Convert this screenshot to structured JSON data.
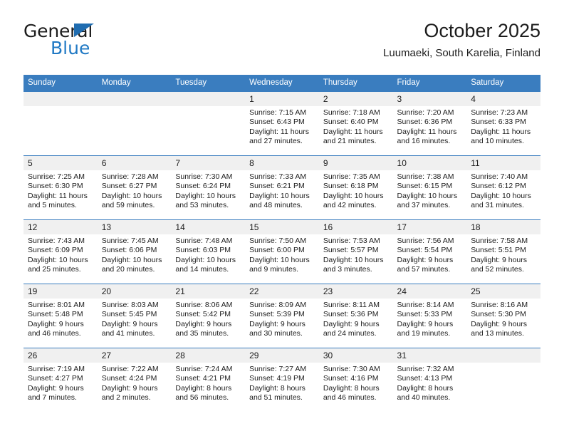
{
  "brand": {
    "name_top": "General",
    "name_bottom": "Blue",
    "accent_color": "#2079c4",
    "header_color": "#3a7dbf"
  },
  "header": {
    "title": "October 2025",
    "subtitle": "Luumaeki, South Karelia, Finland"
  },
  "weekday_headers": [
    "Sunday",
    "Monday",
    "Tuesday",
    "Wednesday",
    "Thursday",
    "Friday",
    "Saturday"
  ],
  "labels": {
    "sunrise": "Sunrise:",
    "sunset": "Sunset:",
    "daylight": "Daylight:"
  },
  "weeks": [
    [
      {
        "empty": true
      },
      {
        "empty": true
      },
      {
        "empty": true
      },
      {
        "day": "1",
        "sunrise": "Sunrise: 7:15 AM",
        "sunset": "Sunset: 6:43 PM",
        "daylight1": "Daylight: 11 hours",
        "daylight2": "and 27 minutes."
      },
      {
        "day": "2",
        "sunrise": "Sunrise: 7:18 AM",
        "sunset": "Sunset: 6:40 PM",
        "daylight1": "Daylight: 11 hours",
        "daylight2": "and 21 minutes."
      },
      {
        "day": "3",
        "sunrise": "Sunrise: 7:20 AM",
        "sunset": "Sunset: 6:36 PM",
        "daylight1": "Daylight: 11 hours",
        "daylight2": "and 16 minutes."
      },
      {
        "day": "4",
        "sunrise": "Sunrise: 7:23 AM",
        "sunset": "Sunset: 6:33 PM",
        "daylight1": "Daylight: 11 hours",
        "daylight2": "and 10 minutes."
      }
    ],
    [
      {
        "day": "5",
        "sunrise": "Sunrise: 7:25 AM",
        "sunset": "Sunset: 6:30 PM",
        "daylight1": "Daylight: 11 hours",
        "daylight2": "and 5 minutes."
      },
      {
        "day": "6",
        "sunrise": "Sunrise: 7:28 AM",
        "sunset": "Sunset: 6:27 PM",
        "daylight1": "Daylight: 10 hours",
        "daylight2": "and 59 minutes."
      },
      {
        "day": "7",
        "sunrise": "Sunrise: 7:30 AM",
        "sunset": "Sunset: 6:24 PM",
        "daylight1": "Daylight: 10 hours",
        "daylight2": "and 53 minutes."
      },
      {
        "day": "8",
        "sunrise": "Sunrise: 7:33 AM",
        "sunset": "Sunset: 6:21 PM",
        "daylight1": "Daylight: 10 hours",
        "daylight2": "and 48 minutes."
      },
      {
        "day": "9",
        "sunrise": "Sunrise: 7:35 AM",
        "sunset": "Sunset: 6:18 PM",
        "daylight1": "Daylight: 10 hours",
        "daylight2": "and 42 minutes."
      },
      {
        "day": "10",
        "sunrise": "Sunrise: 7:38 AM",
        "sunset": "Sunset: 6:15 PM",
        "daylight1": "Daylight: 10 hours",
        "daylight2": "and 37 minutes."
      },
      {
        "day": "11",
        "sunrise": "Sunrise: 7:40 AM",
        "sunset": "Sunset: 6:12 PM",
        "daylight1": "Daylight: 10 hours",
        "daylight2": "and 31 minutes."
      }
    ],
    [
      {
        "day": "12",
        "sunrise": "Sunrise: 7:43 AM",
        "sunset": "Sunset: 6:09 PM",
        "daylight1": "Daylight: 10 hours",
        "daylight2": "and 25 minutes."
      },
      {
        "day": "13",
        "sunrise": "Sunrise: 7:45 AM",
        "sunset": "Sunset: 6:06 PM",
        "daylight1": "Daylight: 10 hours",
        "daylight2": "and 20 minutes."
      },
      {
        "day": "14",
        "sunrise": "Sunrise: 7:48 AM",
        "sunset": "Sunset: 6:03 PM",
        "daylight1": "Daylight: 10 hours",
        "daylight2": "and 14 minutes."
      },
      {
        "day": "15",
        "sunrise": "Sunrise: 7:50 AM",
        "sunset": "Sunset: 6:00 PM",
        "daylight1": "Daylight: 10 hours",
        "daylight2": "and 9 minutes."
      },
      {
        "day": "16",
        "sunrise": "Sunrise: 7:53 AM",
        "sunset": "Sunset: 5:57 PM",
        "daylight1": "Daylight: 10 hours",
        "daylight2": "and 3 minutes."
      },
      {
        "day": "17",
        "sunrise": "Sunrise: 7:56 AM",
        "sunset": "Sunset: 5:54 PM",
        "daylight1": "Daylight: 9 hours",
        "daylight2": "and 57 minutes."
      },
      {
        "day": "18",
        "sunrise": "Sunrise: 7:58 AM",
        "sunset": "Sunset: 5:51 PM",
        "daylight1": "Daylight: 9 hours",
        "daylight2": "and 52 minutes."
      }
    ],
    [
      {
        "day": "19",
        "sunrise": "Sunrise: 8:01 AM",
        "sunset": "Sunset: 5:48 PM",
        "daylight1": "Daylight: 9 hours",
        "daylight2": "and 46 minutes."
      },
      {
        "day": "20",
        "sunrise": "Sunrise: 8:03 AM",
        "sunset": "Sunset: 5:45 PM",
        "daylight1": "Daylight: 9 hours",
        "daylight2": "and 41 minutes."
      },
      {
        "day": "21",
        "sunrise": "Sunrise: 8:06 AM",
        "sunset": "Sunset: 5:42 PM",
        "daylight1": "Daylight: 9 hours",
        "daylight2": "and 35 minutes."
      },
      {
        "day": "22",
        "sunrise": "Sunrise: 8:09 AM",
        "sunset": "Sunset: 5:39 PM",
        "daylight1": "Daylight: 9 hours",
        "daylight2": "and 30 minutes."
      },
      {
        "day": "23",
        "sunrise": "Sunrise: 8:11 AM",
        "sunset": "Sunset: 5:36 PM",
        "daylight1": "Daylight: 9 hours",
        "daylight2": "and 24 minutes."
      },
      {
        "day": "24",
        "sunrise": "Sunrise: 8:14 AM",
        "sunset": "Sunset: 5:33 PM",
        "daylight1": "Daylight: 9 hours",
        "daylight2": "and 19 minutes."
      },
      {
        "day": "25",
        "sunrise": "Sunrise: 8:16 AM",
        "sunset": "Sunset: 5:30 PM",
        "daylight1": "Daylight: 9 hours",
        "daylight2": "and 13 minutes."
      }
    ],
    [
      {
        "day": "26",
        "sunrise": "Sunrise: 7:19 AM",
        "sunset": "Sunset: 4:27 PM",
        "daylight1": "Daylight: 9 hours",
        "daylight2": "and 7 minutes."
      },
      {
        "day": "27",
        "sunrise": "Sunrise: 7:22 AM",
        "sunset": "Sunset: 4:24 PM",
        "daylight1": "Daylight: 9 hours",
        "daylight2": "and 2 minutes."
      },
      {
        "day": "28",
        "sunrise": "Sunrise: 7:24 AM",
        "sunset": "Sunset: 4:21 PM",
        "daylight1": "Daylight: 8 hours",
        "daylight2": "and 56 minutes."
      },
      {
        "day": "29",
        "sunrise": "Sunrise: 7:27 AM",
        "sunset": "Sunset: 4:19 PM",
        "daylight1": "Daylight: 8 hours",
        "daylight2": "and 51 minutes."
      },
      {
        "day": "30",
        "sunrise": "Sunrise: 7:30 AM",
        "sunset": "Sunset: 4:16 PM",
        "daylight1": "Daylight: 8 hours",
        "daylight2": "and 46 minutes."
      },
      {
        "day": "31",
        "sunrise": "Sunrise: 7:32 AM",
        "sunset": "Sunset: 4:13 PM",
        "daylight1": "Daylight: 8 hours",
        "daylight2": "and 40 minutes."
      },
      {
        "empty": true
      }
    ]
  ]
}
